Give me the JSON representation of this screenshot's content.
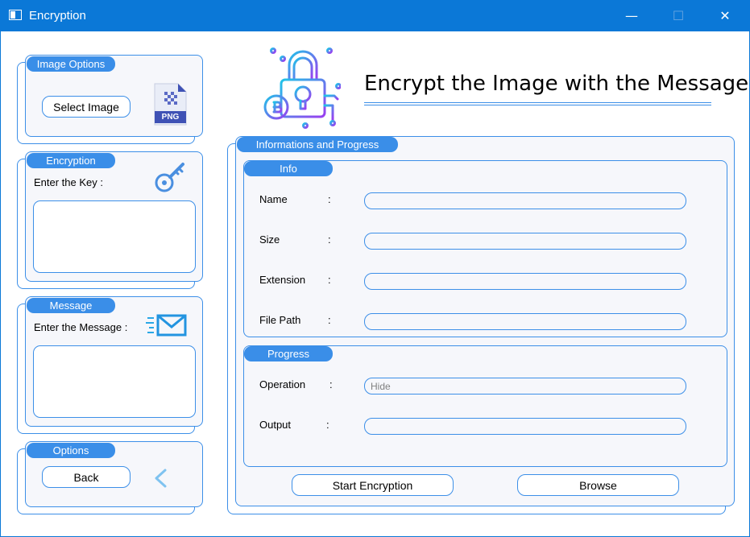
{
  "window": {
    "title": "Encryption",
    "minimize": "—",
    "maximize": "☐",
    "close": "✕"
  },
  "heading": "Encrypt the Image with the Message",
  "image_options": {
    "tag": "Image Options",
    "select_button": "Select Image",
    "file_icon_text": "PNG"
  },
  "encryption": {
    "tag": "Encryption",
    "key_label": "Enter the Key :",
    "key_value": ""
  },
  "message": {
    "tag": "Message",
    "message_label": "Enter the Message :",
    "message_value": ""
  },
  "options": {
    "tag": "Options",
    "back_button": "Back"
  },
  "info_progress": {
    "tag": "Informations and Progress",
    "info": {
      "tag": "Info",
      "rows": [
        {
          "label": "Name",
          "colon": ":",
          "value": ""
        },
        {
          "label": "Size",
          "colon": ":",
          "value": ""
        },
        {
          "label": "Extension",
          "colon": ":",
          "value": ""
        },
        {
          "label": "File Path",
          "colon": ":",
          "value": ""
        }
      ]
    },
    "progress": {
      "tag": "Progress",
      "operation": {
        "label": "Operation",
        "colon": ":",
        "placeholder": "Hide",
        "value": ""
      },
      "output": {
        "label": "Output",
        "colon": ":",
        "value": ""
      }
    },
    "start_button": "Start Encryption",
    "browse_button": "Browse"
  },
  "colors": {
    "accent": "#3a8ee8",
    "titlebar": "#0b78d7",
    "panel_bg": "#f6f7fb"
  }
}
